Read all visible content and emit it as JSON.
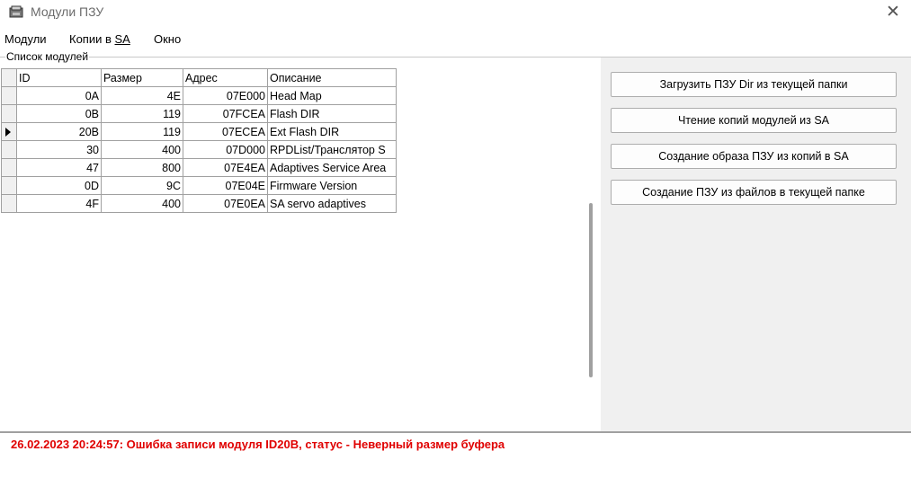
{
  "window": {
    "title": "Модули ПЗУ",
    "icon": "drive-icon",
    "close_glyph": "✕"
  },
  "menu": [
    "Модули",
    "Копии в ",
    "SA",
    "Окно"
  ],
  "group_label": "Список модулей",
  "grid": {
    "columns": [
      "ID",
      "Размер",
      "Адрес",
      "Описание"
    ],
    "rows": [
      [
        "0A",
        "4E",
        "07E000",
        "Head Map"
      ],
      [
        "0B",
        "119",
        "07FCEA",
        "Flash DIR"
      ],
      [
        "20B",
        "119",
        "07ECEA",
        "Ext Flash DIR"
      ],
      [
        "30",
        "400",
        "07D000",
        "RPDList/Транслятор S"
      ],
      [
        "47",
        "800",
        "07E4EA",
        "Adaptives Service Area"
      ],
      [
        "0D",
        "9C",
        "07E04E",
        "Firmware Version"
      ],
      [
        "4F",
        "400",
        "07E0EA",
        "SA servo adaptives"
      ]
    ],
    "current_row_index": 2
  },
  "buttons": [
    "Загрузить ПЗУ Dir из текущей папки",
    "Чтение копий модулей из SA",
    "Создание образа ПЗУ из копий в SA",
    "Создание ПЗУ из файлов в текущей папке"
  ],
  "log": [
    "26.02.2023 20:24:57: Ошибка записи модуля ID20B, статус - Неверный размер буфера"
  ],
  "colors": {
    "log_error": "#e00000",
    "panel_bg": "#f0f0f0"
  }
}
